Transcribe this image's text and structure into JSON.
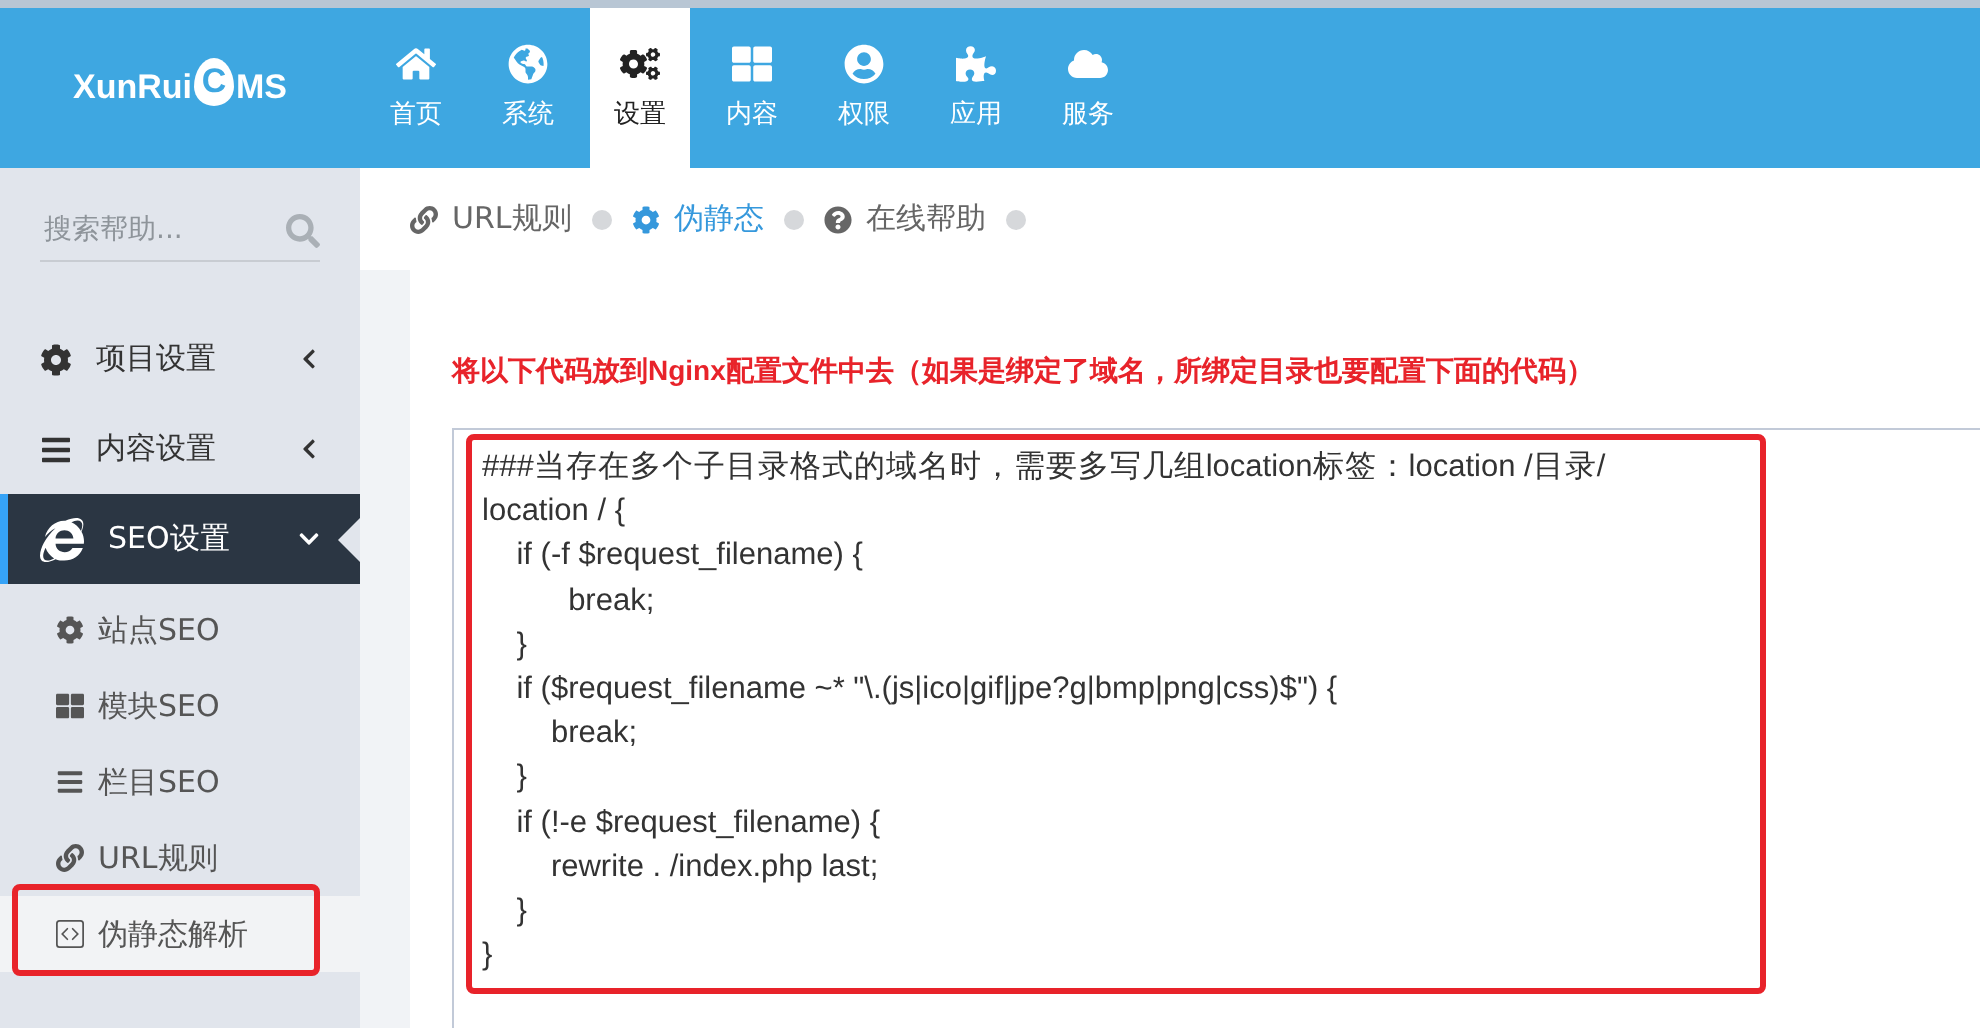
{
  "logo": {
    "before": "XunRui",
    "mark": "C",
    "after": "MS"
  },
  "nav": [
    {
      "label": "首页",
      "selected": false
    },
    {
      "label": "系统",
      "selected": false
    },
    {
      "label": "设置",
      "selected": true
    },
    {
      "label": "内容",
      "selected": false
    },
    {
      "label": "权限",
      "selected": false
    },
    {
      "label": "应用",
      "selected": false
    },
    {
      "label": "服务",
      "selected": false
    }
  ],
  "search": {
    "placeholder": "搜索帮助..."
  },
  "breadcrumb": [
    {
      "label": "URL规则",
      "selected": false
    },
    {
      "label": "伪静态",
      "selected": true
    },
    {
      "label": "在线帮助",
      "selected": false
    }
  ],
  "sidebar": [
    {
      "label": "项目设置",
      "expanded": false
    },
    {
      "label": "内容设置",
      "expanded": false
    },
    {
      "label": "SEO设置",
      "expanded": true,
      "children": [
        {
          "label": "站点SEO",
          "selected": false,
          "highlighted": false
        },
        {
          "label": "模块SEO",
          "selected": false,
          "highlighted": false
        },
        {
          "label": "栏目SEO",
          "selected": false,
          "highlighted": false
        },
        {
          "label": "URL规则",
          "selected": false,
          "highlighted": false
        },
        {
          "label": "伪静态解析",
          "selected": true,
          "highlighted": true
        }
      ]
    }
  ],
  "notice": "将以下代码放到Nginx配置文件中去（如果是绑定了域名，所绑定目录也要配置下面的代码）",
  "code": {
    "highlighted": true,
    "lines": [
      "###当存在多个子目录格式的域名时，需要多写几组location标签：location /目录/",
      "location / {",
      "    if (-f $request_filename) {",
      "          break;",
      "    }",
      "    if ($request_filename ~* \"\\.(js|ico|gif|jpe?g|bmp|png|css)$\") {",
      "        break;",
      "    }",
      "    if (!-e $request_filename) {",
      "        rewrite . /index.php last;",
      "    }",
      "}"
    ]
  }
}
